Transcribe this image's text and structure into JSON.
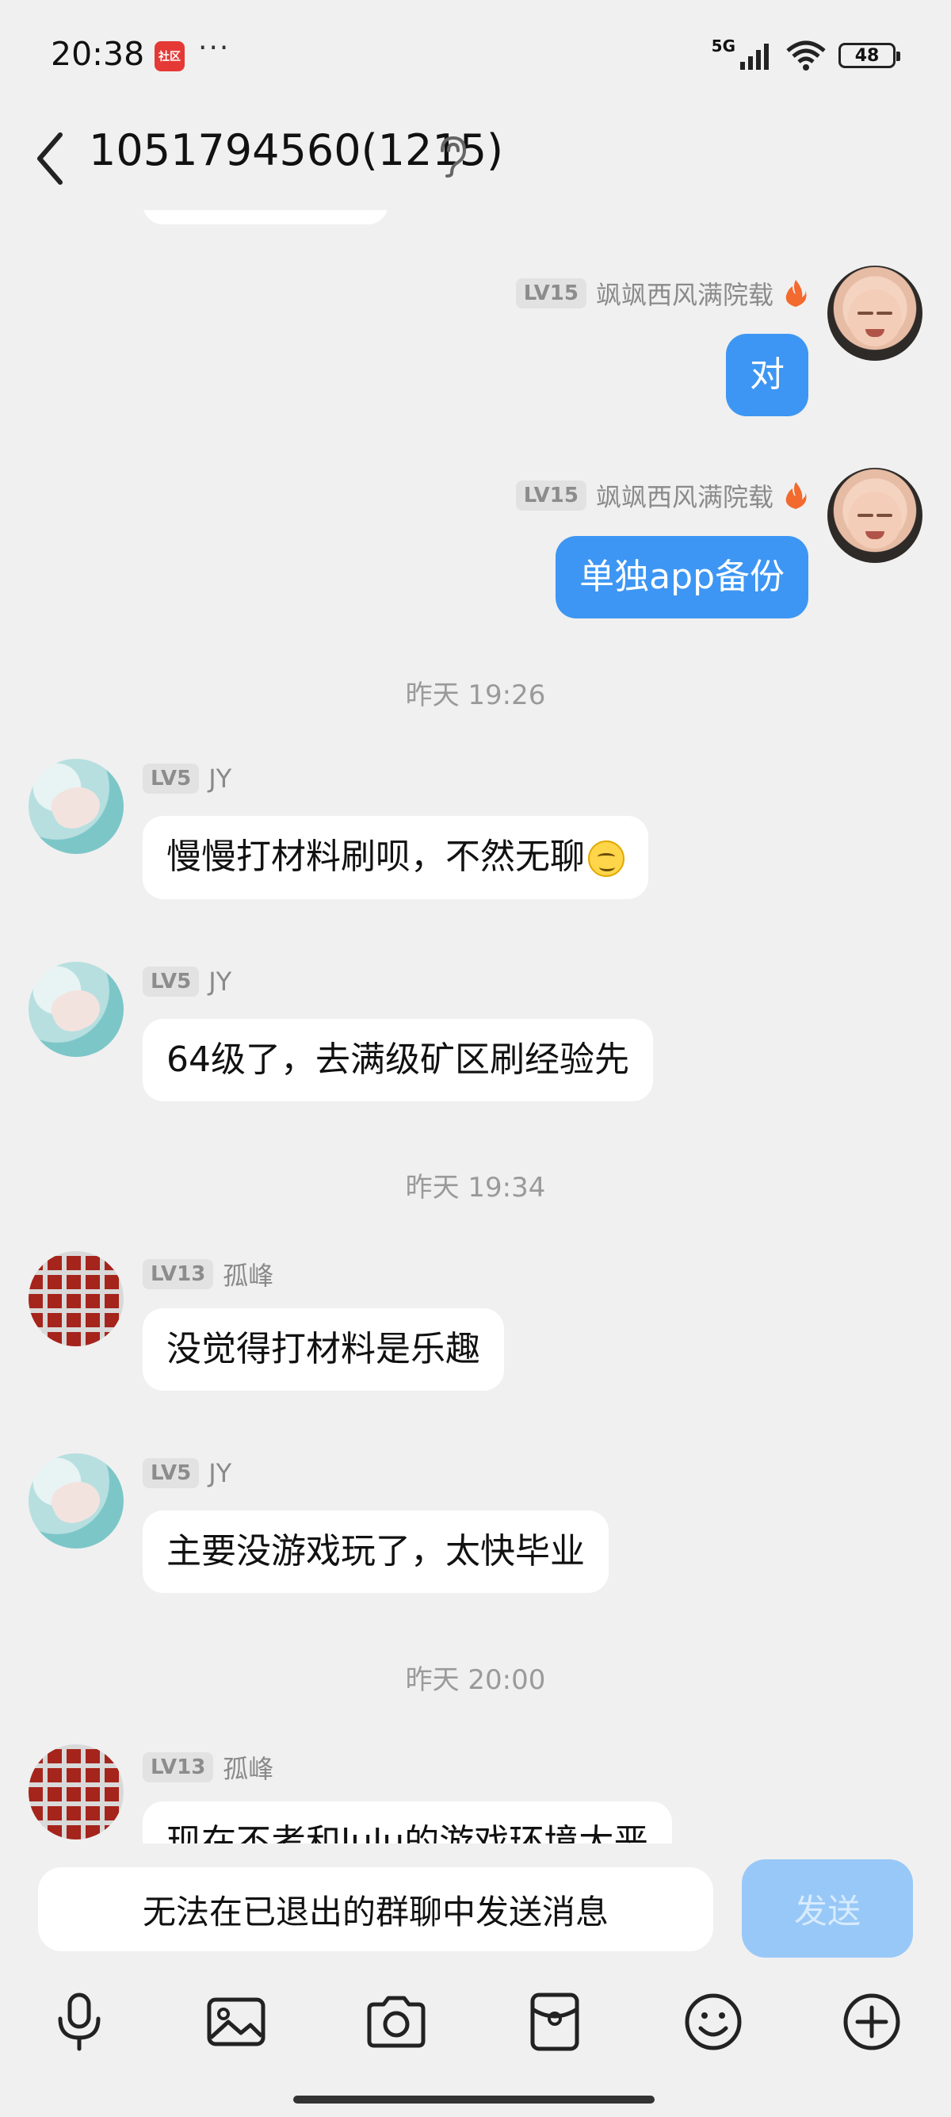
{
  "status_bar": {
    "time": "20:38",
    "app_badge": "社区",
    "dots": "···",
    "network": "5G",
    "battery": "48"
  },
  "header": {
    "title": "1051794560(1215)"
  },
  "messages": [
    {
      "type": "mine",
      "level": "LV15",
      "nickname": "飒飒西风满院载",
      "text": "对"
    },
    {
      "type": "mine",
      "level": "LV15",
      "nickname": "飒飒西风满院载",
      "text": "单独app备份"
    },
    {
      "type": "time",
      "text": "昨天 19:26"
    },
    {
      "type": "other",
      "level": "LV5",
      "nickname": "JY",
      "text": "慢慢打材料刷呗，不然无聊"
    },
    {
      "type": "other",
      "level": "LV5",
      "nickname": "JY",
      "text": "64级了，去满级矿区刷经验先"
    },
    {
      "type": "time",
      "text": "昨天 19:34"
    },
    {
      "type": "other",
      "level": "LV13",
      "nickname": "孤峰",
      "text": "没觉得打材料是乐趣"
    },
    {
      "type": "other",
      "level": "LV5",
      "nickname": "JY",
      "text": "主要没游戏玩了，太快毕业"
    },
    {
      "type": "time",
      "text": "昨天 20:00"
    },
    {
      "type": "other",
      "level": "LV13",
      "nickname": "孤峰",
      "text": "现在不考和lulu的游戏环境太恶"
    }
  ],
  "input": {
    "disabled_text": "无法在已退出的群聊中发送消息",
    "send_label": "发送"
  },
  "toolbar": [
    "mic-icon",
    "image-icon",
    "camera-icon",
    "red-packet-icon",
    "emoji-icon",
    "plus-icon"
  ],
  "colors": {
    "background": "#f0f0f0",
    "my_bubble": "#3d96f3",
    "send_disabled": "#98c8f7"
  }
}
